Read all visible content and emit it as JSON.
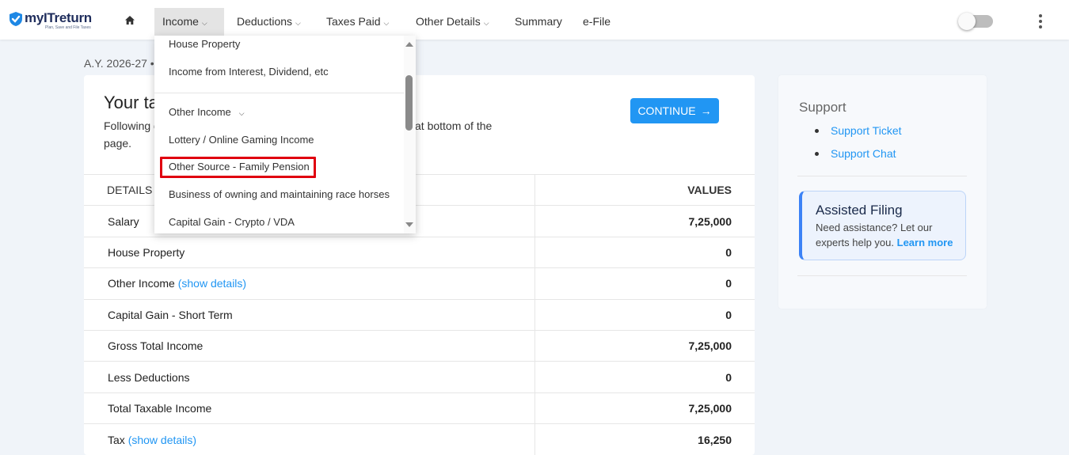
{
  "brand": {
    "name": "myITreturn",
    "tagline": "Plan, Save and File Taxes"
  },
  "nav": {
    "income": "Income",
    "deductions": "Deductions",
    "taxes_paid": "Taxes Paid",
    "other_details": "Other Details",
    "summary": "Summary",
    "efile": "e-File"
  },
  "ay_line": "A.Y. 2026-27 •",
  "card": {
    "title": "Your ta",
    "desc_start": "Following d",
    "desc_end": "at bottom of the",
    "desc_line2": "page.",
    "continue_label": "CONTINUE"
  },
  "table": {
    "col_details": "DETAILS",
    "col_values": "VALUES",
    "show_details": "(show details)",
    "rows": [
      {
        "label": "Salary",
        "value": "7,25,000"
      },
      {
        "label": "House Property",
        "value": "0"
      },
      {
        "label": "Other Income",
        "value": "0"
      },
      {
        "label": "Capital Gain - Short Term",
        "value": "0"
      },
      {
        "label": "Gross Total Income",
        "value": "7,25,000"
      },
      {
        "label": "Less Deductions",
        "value": "0"
      },
      {
        "label": "Total Taxable Income",
        "value": "7,25,000"
      },
      {
        "label": "Tax",
        "value": "16,250"
      }
    ]
  },
  "support": {
    "title": "Support",
    "ticket": "Support Ticket",
    "chat": "Support Chat"
  },
  "assisted": {
    "title": "Assisted Filing",
    "text": "Need assistance? Let our experts help you.",
    "link": "Learn more"
  },
  "dropdown": {
    "items": [
      "House Property",
      "Income from Interest, Dividend, etc",
      "Other Income",
      "Lottery / Online Gaming Income",
      "Other Source - Family Pension",
      "Business of owning and maintaining race horses",
      "Capital Gain - Crypto / VDA"
    ]
  },
  "colors": {
    "accent": "#2196f3",
    "highlight": "#e0000f",
    "brand": "#1f2d5c"
  }
}
